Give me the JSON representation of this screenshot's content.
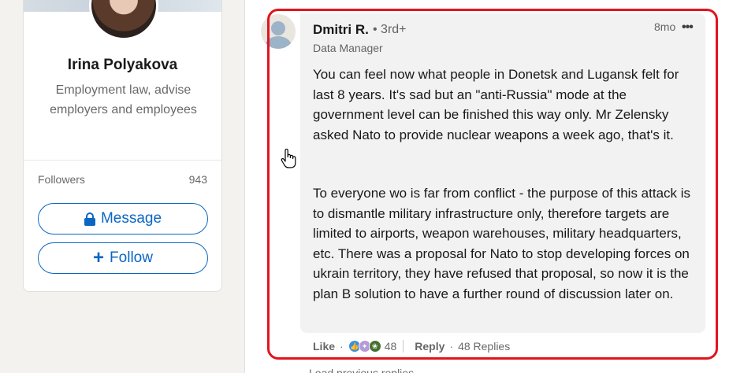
{
  "profile": {
    "name": "Irina Polyakova",
    "headline": "Employment law, advise employers and employees",
    "followers_label": "Followers",
    "followers_count": "943",
    "message_label": "Message",
    "follow_label": "Follow"
  },
  "comment": {
    "author": "Dmitri R.",
    "degree": "• 3rd+",
    "title": "Data Manager",
    "time": "8mo",
    "more": "•••",
    "paragraph_1": "You can feel now what people in Donetsk and Lugansk felt for last 8 years. It's sad but an \"anti-Russia\" mode at the government level can be finished this way only. Mr Zelensky asked Nato to provide nuclear weapons a week ago, that's it.",
    "paragraph_2": "To everyone wo is far from conflict - the purpose of this attack is to dismantle military infrastructure only, therefore targets are limited to airports, weapon warehouses, military headquarters, etc. There was a proposal for Nato to stop developing forces on ukrain territory, they have refused that proposal, so now it is the plan B solution to have a further round of discussion later on.",
    "actions": {
      "like_label": "Like",
      "separator": "·",
      "reaction_count": "48",
      "reply_label": "Reply",
      "replies_label": "48 Replies"
    }
  },
  "load_previous": "Load previous replies",
  "colors": {
    "accent": "#0a66c2",
    "highlight": "#e2141e",
    "bubble": "#f2f2f2"
  },
  "icons": [
    "lock-icon",
    "plus-icon",
    "more-icon",
    "hand-cursor-icon",
    "like-reaction-icon",
    "celebrate-reaction-icon",
    "support-reaction-icon"
  ]
}
